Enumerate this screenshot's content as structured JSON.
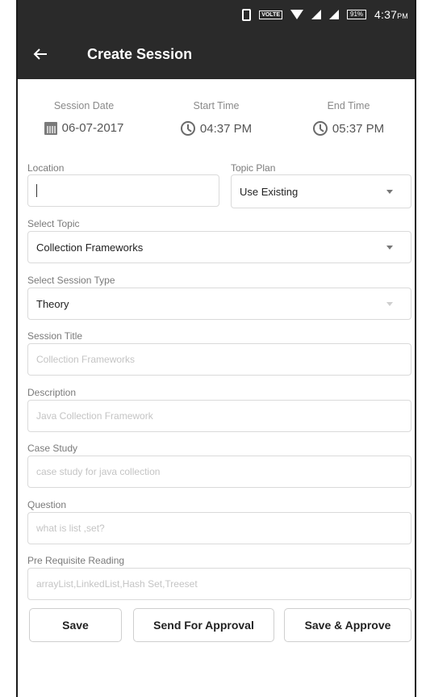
{
  "status_bar": {
    "volte": "VOLTE",
    "battery": "91%",
    "time": "4:37",
    "ampm": "PM"
  },
  "app_bar": {
    "title": "Create Session",
    "back_icon": "arrow-back-icon"
  },
  "schedule": {
    "session_date": {
      "label": "Session Date",
      "value": "06-07-2017",
      "icon": "calendar-icon"
    },
    "start_time": {
      "label": "Start Time",
      "value": "04:37 PM",
      "icon": "clock-icon"
    },
    "end_time": {
      "label": "End Time",
      "value": "05:37 PM",
      "icon": "clock-icon"
    }
  },
  "form": {
    "location": {
      "label": "Location",
      "value": ""
    },
    "topic_plan": {
      "label": "Topic Plan",
      "value": "Use Existing"
    },
    "topic": {
      "label": "Select Topic",
      "value": "Collection Frameworks"
    },
    "session_type": {
      "label": "Select Session Type",
      "value": "Theory"
    },
    "session_title": {
      "label": "Session Title",
      "placeholder": "Collection Frameworks"
    },
    "description": {
      "label": "Description",
      "placeholder": "Java Collection Framework"
    },
    "case_study": {
      "label": "Case Study",
      "placeholder": "case study for java collection"
    },
    "question": {
      "label": "Question",
      "placeholder": "what is list ,set?"
    },
    "pre_requisite": {
      "label": "Pre Requisite Reading",
      "placeholder": "arrayList,LinkedList,Hash Set,Treeset"
    }
  },
  "actions": {
    "save": "Save",
    "send_for_approval": "Send For Approval",
    "save_and_approve": "Save & Approve"
  },
  "colors": {
    "app_bar": "#2a2a2a",
    "border": "#dadada",
    "label": "#7a7a7a"
  }
}
